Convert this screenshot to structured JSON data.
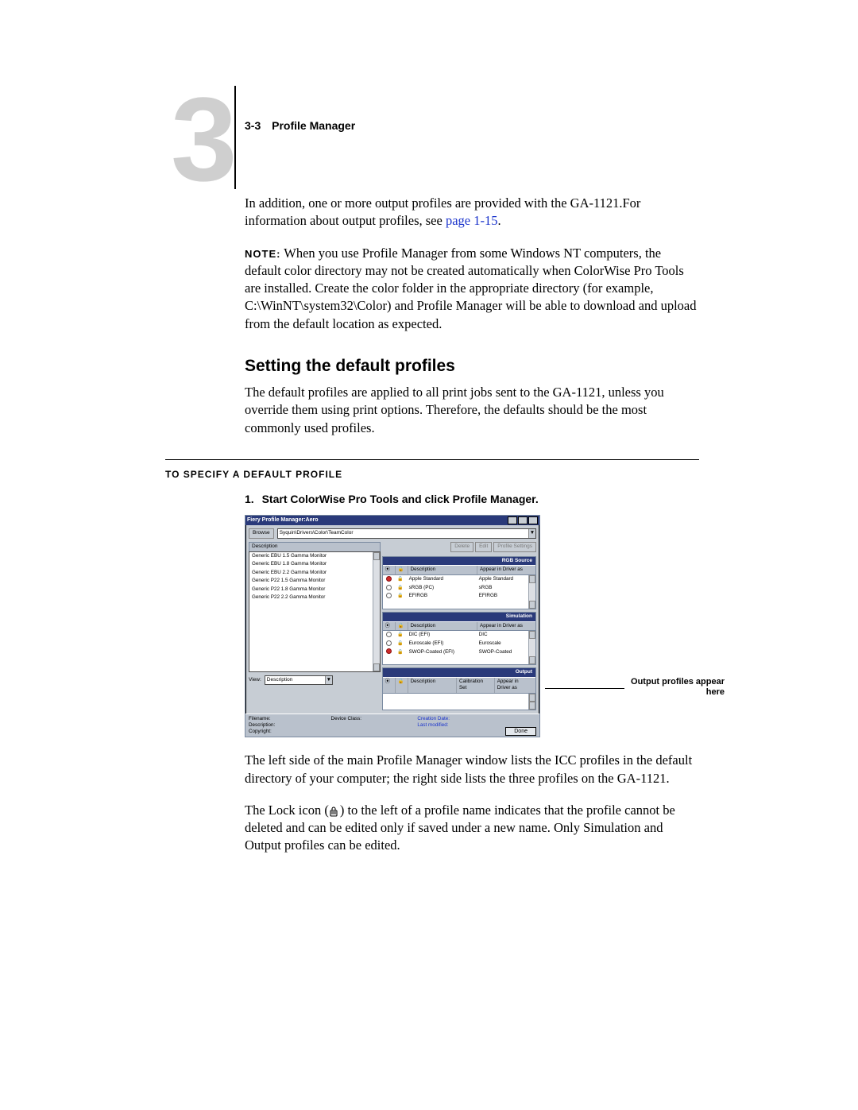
{
  "header": {
    "page_num": "3-3",
    "title": "Profile Manager",
    "chapter_digit": "3"
  },
  "body": {
    "p1_a": "In addition, one or more output profiles are provided with the GA-1121.For information about output profiles, see ",
    "p1_link": "page 1-15",
    "p1_b": ".",
    "note_label": "NOTE:",
    "p2": "When you use Profile Manager from some Windows NT computers, the default color directory may not be created automatically when ColorWise Pro Tools are installed. Create the color folder in the appropriate directory (for example, C:\\WinNT\\system32\\Color) and Profile Manager will be able to download and upload from the default location as expected.",
    "h2": "Setting the default profiles",
    "p3": "The default profiles are applied to all print jobs sent to the GA-1121, unless you override them using print options. Therefore, the defaults should be the most commonly used profiles.",
    "proc_label": "To specify a default profile",
    "step1_num": "1.",
    "step1_text": "Start ColorWise Pro Tools and click Profile Manager.",
    "after_shot_1a": "The left side of the main Profile Manager window lists the ICC profiles in the default directory of your computer; the right side lists the three profiles on the GA-1121.",
    "after_shot_2a": "The Lock icon (",
    "after_shot_2b": ") to the left of a profile name indicates that the profile cannot be deleted and can be edited only if saved under a new name. Only Simulation and Output profiles can be edited."
  },
  "callout": "Output profiles appear here",
  "shot": {
    "title": "Fiery Profile Manager:Aero",
    "browse_label": "Browse",
    "browse_path": "Syquin\\Drivers\\Color\\TeamColor",
    "left_header": "Description",
    "left_items": [
      "Generic EBU 1.5 Gamma Monitor",
      "Generic EBU 1.8 Gamma Monitor",
      "Generic EBU 2.2 Gamma Monitor",
      "Generic P22 1.5 Gamma Monitor",
      "Generic P22 1.8 Gamma Monitor",
      "Generic P22 2.2 Gamma Monitor"
    ],
    "view_label": "View:",
    "view_value": "Description",
    "buttons": {
      "delete": "Delete",
      "edit": "Edit",
      "define": "Profile Settings"
    },
    "col_desc": "Description",
    "col_app": "Appear in Driver as",
    "col_cal": "Calibration Set",
    "panel_rgb": {
      "title": "RGB Source",
      "rows": [
        {
          "desc": "Apple Standard",
          "app": "Apple Standard",
          "default": true
        },
        {
          "desc": "sRGB (PC)",
          "app": "sRGB",
          "default": false
        },
        {
          "desc": "EFIRGB",
          "app": "EFIRGB",
          "default": false
        }
      ]
    },
    "panel_sim": {
      "title": "Simulation",
      "rows": [
        {
          "desc": "DIC (EFI)",
          "app": "DIC",
          "default": false
        },
        {
          "desc": "Euroscale (EFI)",
          "app": "Euroscale",
          "default": false
        },
        {
          "desc": "SWOP-Coated (EFI)",
          "app": "SWOP-Coated",
          "default": true
        }
      ]
    },
    "panel_out": {
      "title": "Output"
    },
    "info": {
      "filename": "Filename:",
      "description": "Description:",
      "copyright": "Copyright:",
      "device": "Device Class:",
      "created": "Creation Date:",
      "modified": "Last modified:"
    },
    "done": "Done"
  }
}
